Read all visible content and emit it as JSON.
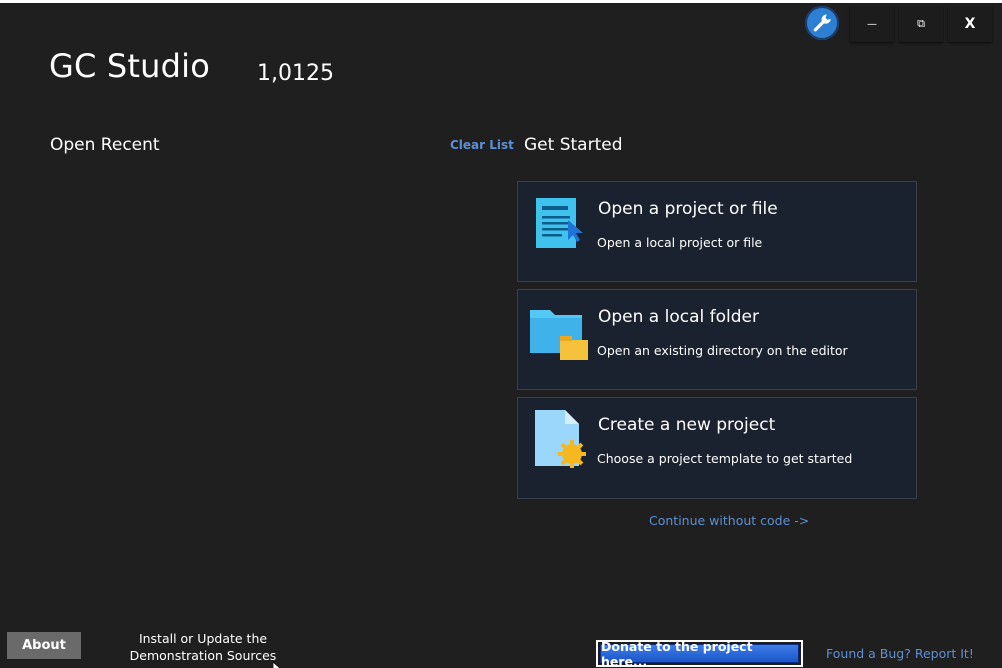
{
  "app": {
    "title": "GC Studio",
    "version": "1,0125"
  },
  "titlebar": {
    "tools_icon": "wrench-icon",
    "minimize_label": "—",
    "maximize_label": "⧉",
    "close_label": "X"
  },
  "recent": {
    "heading": "Open Recent",
    "clear_label": "Clear List"
  },
  "get_started": {
    "heading": "Get Started",
    "cards": [
      {
        "title": "Open a project or file",
        "description": "Open a local project or file",
        "icon": "document-icon"
      },
      {
        "title": "Open a local folder",
        "description": "Open an existing directory on the editor",
        "icon": "folder-icon"
      },
      {
        "title": "Create a new project",
        "description": "Choose a project template to get started",
        "icon": "new-file-icon"
      }
    ],
    "continue_label": "Continue without code ->"
  },
  "footer": {
    "about_label": "About",
    "install_label": "Install or Update the Demonstration Sources",
    "donate_label": "Donate to the project here...",
    "bug_label": "Found a Bug? Report It!"
  },
  "colors": {
    "background": "#1f1f1f",
    "card_bg": "#1a2230",
    "link": "#5d8fd6",
    "donate": "#2a66d8"
  }
}
